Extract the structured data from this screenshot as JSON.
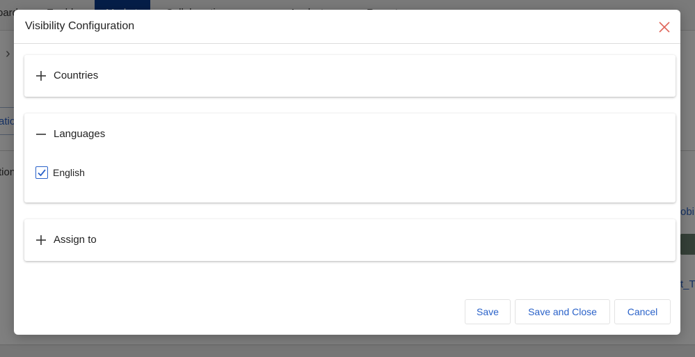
{
  "background": {
    "nav_items": [
      "oard",
      "Enablem",
      "Market",
      "Collaborative spaces",
      "Analyst",
      "Report"
    ],
    "fragments": {
      "left_1": "atio",
      "left_2": "tion",
      "right_1": "obi",
      "right_2": "t_T"
    }
  },
  "modal": {
    "title": "Visibility Configuration",
    "close_icon": "close-icon"
  },
  "panels": [
    {
      "label": "Countries",
      "expanded": false,
      "toggle_icon": "plus-icon"
    },
    {
      "label": "Languages",
      "expanded": true,
      "toggle_icon": "minus-icon",
      "options": [
        {
          "label": "English",
          "checked": true
        }
      ]
    },
    {
      "label": "Assign to",
      "expanded": false,
      "toggle_icon": "plus-icon"
    }
  ],
  "buttons": {
    "save": "Save",
    "save_and_close": "Save and Close",
    "cancel": "Cancel"
  },
  "colors": {
    "accent": "#2a62c9",
    "close": "#e0655a"
  }
}
